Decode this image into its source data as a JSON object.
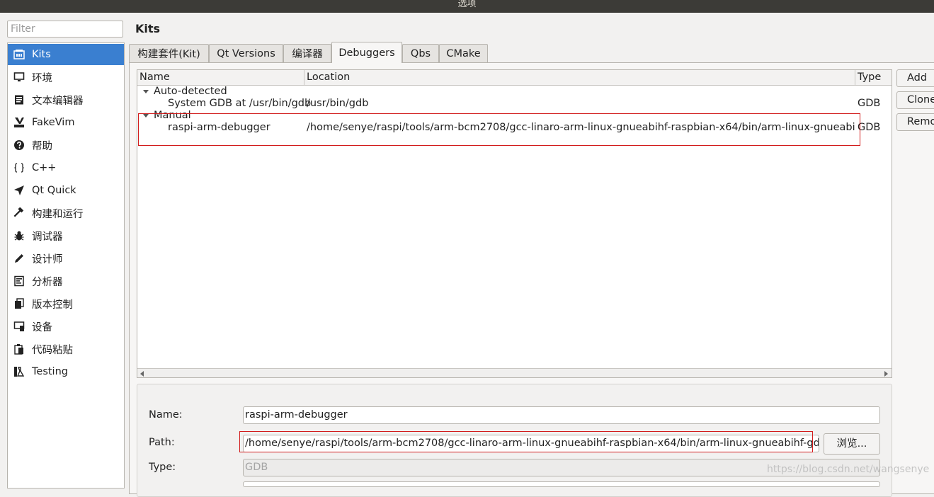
{
  "window": {
    "title": "选项"
  },
  "filter": {
    "placeholder": "Filter"
  },
  "sidebar": {
    "items": [
      {
        "label": "Kits",
        "icon": "kits-icon",
        "selected": true
      },
      {
        "label": "环境",
        "icon": "monitor-icon"
      },
      {
        "label": "文本编辑器",
        "icon": "text-editor-icon"
      },
      {
        "label": "FakeVim",
        "icon": "fakevim-icon"
      },
      {
        "label": "帮助",
        "icon": "help-icon"
      },
      {
        "label": "C++",
        "icon": "braces-icon"
      },
      {
        "label": "Qt Quick",
        "icon": "qt-quick-icon"
      },
      {
        "label": "构建和运行",
        "icon": "hammer-icon"
      },
      {
        "label": "调试器",
        "icon": "bug-icon"
      },
      {
        "label": "设计师",
        "icon": "pencil-icon"
      },
      {
        "label": "分析器",
        "icon": "analyzer-icon"
      },
      {
        "label": "版本控制",
        "icon": "version-control-icon"
      },
      {
        "label": "设备",
        "icon": "device-icon"
      },
      {
        "label": "代码粘贴",
        "icon": "code-paste-icon"
      },
      {
        "label": "Testing",
        "icon": "testing-icon"
      }
    ]
  },
  "page": {
    "title": "Kits"
  },
  "tabs": [
    {
      "label": "构建套件(Kit)"
    },
    {
      "label": "Qt Versions"
    },
    {
      "label": "编译器"
    },
    {
      "label": "Debuggers",
      "active": true
    },
    {
      "label": "Qbs"
    },
    {
      "label": "CMake"
    }
  ],
  "tree": {
    "columns": [
      "Name",
      "Location",
      "Type"
    ],
    "groups": [
      {
        "label": "Auto-detected",
        "rows": [
          {
            "name": "System GDB at /usr/bin/gdb",
            "location": "/usr/bin/gdb",
            "type": "GDB"
          }
        ]
      },
      {
        "label": "Manual",
        "rows": [
          {
            "name": "raspi-arm-debugger",
            "location": "/home/senye/raspi/tools/arm-bcm2708/gcc-linaro-arm-linux-gnueabihf-raspbian-x64/bin/arm-linux-gnueabihf-gdb",
            "type": "GDB"
          }
        ]
      }
    ]
  },
  "buttons": {
    "add": "Add",
    "clone": "Clone",
    "remove": "Remove",
    "browse": "浏览..."
  },
  "details": {
    "name_label": "Name:",
    "name_value": "raspi-arm-debugger",
    "path_label": "Path:",
    "path_value": "/home/senye/raspi/tools/arm-bcm2708/gcc-linaro-arm-linux-gnueabihf-raspbian-x64/bin/arm-linux-gnueabihf-gdb",
    "type_label": "Type:",
    "type_value": "GDB"
  },
  "watermark": "https://blog.csdn.net/wangsenye",
  "colors": {
    "selection": "#3a7fd0",
    "annotation": "#d21c1c",
    "titlebar": "#3c3b37"
  }
}
